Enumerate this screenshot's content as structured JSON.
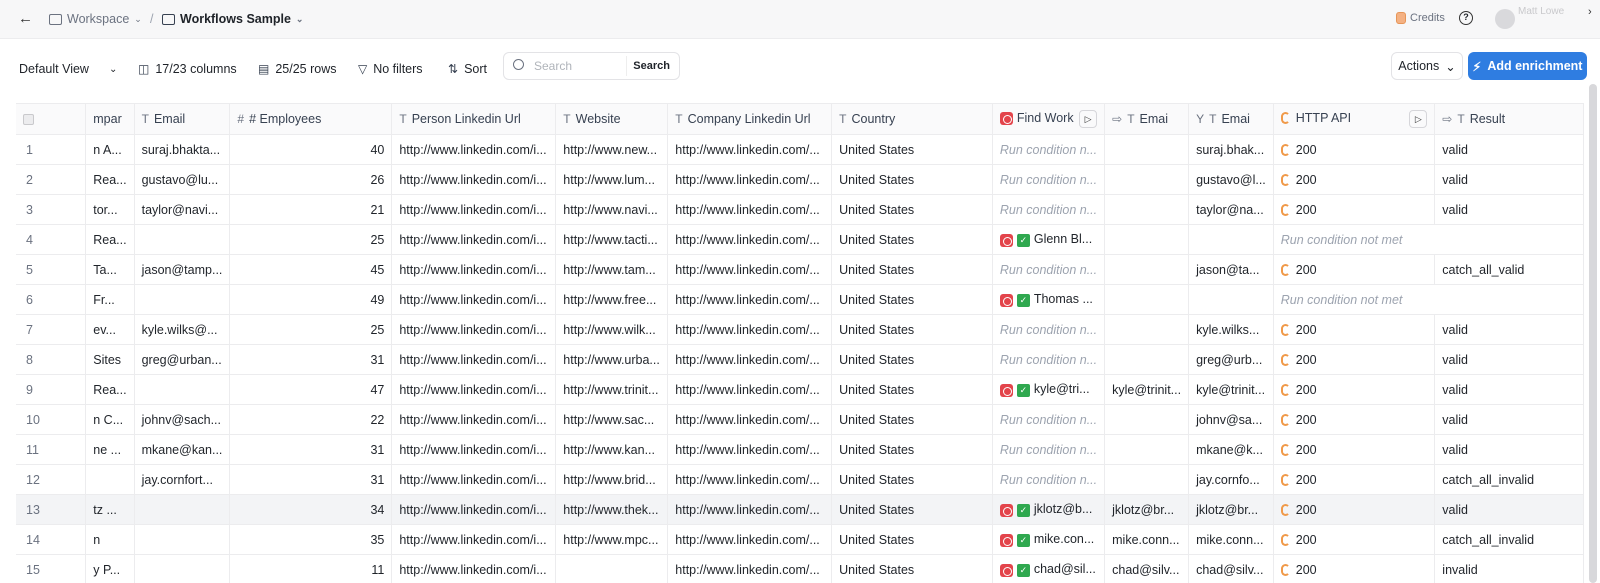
{
  "topbar": {
    "workspace": "Workspace",
    "separator": "/",
    "workflow": "Workflows Sample",
    "credits": "Credits",
    "user": "Matt Lowe"
  },
  "toolbar": {
    "view": "Default View",
    "columns": "17/23 columns",
    "rows": "25/25 rows",
    "filters": "No filters",
    "sort": "Sort",
    "search_placeholder": "Search",
    "search_button": "Search",
    "actions": "Actions",
    "add_enrichment": "Add enrichment"
  },
  "columns": [
    "mpar",
    "Email",
    "# Employees",
    "Person Linkedin Url",
    "Website",
    "Company Linkedin Url",
    "Country",
    "Find Work",
    "Emai",
    "Emai",
    "HTTP API",
    "Result"
  ],
  "rows": [
    {
      "n": "1",
      "company": "n A...",
      "email": "suraj.bhakta...",
      "employees": "40",
      "person": "http://www.linkedin.com/i...",
      "website": "http://www.new...",
      "clinkedin": "http://www.linkedin.com/...",
      "country": "United States",
      "findwork": "Run condition n...",
      "email2": "",
      "email3": "suraj.bhak...",
      "api": "200",
      "result": "valid"
    },
    {
      "n": "2",
      "company": "Rea...",
      "email": "gustavo@lu...",
      "employees": "26",
      "person": "http://www.linkedin.com/i...",
      "website": "http://www.lum...",
      "clinkedin": "http://www.linkedin.com/...",
      "country": "United States",
      "findwork": "Run condition n...",
      "email2": "",
      "email3": "gustavo@l...",
      "api": "200",
      "result": "valid"
    },
    {
      "n": "3",
      "company": "tor...",
      "email": "taylor@navi...",
      "employees": "21",
      "person": "http://www.linkedin.com/i...",
      "website": "http://www.navi...",
      "clinkedin": "http://www.linkedin.com/...",
      "country": "United States",
      "findwork": "Run condition n...",
      "email2": "",
      "email3": "taylor@na...",
      "api": "200",
      "result": "valid"
    },
    {
      "n": "4",
      "company": "Rea...",
      "email": "",
      "employees": "25",
      "person": "http://www.linkedin.com/i...",
      "website": "http://www.tacti...",
      "clinkedin": "http://www.linkedin.com/...",
      "country": "United States",
      "findwork": "Glenn Bl...",
      "email2": "",
      "email3": "",
      "api": "Run condition not met",
      "result": ""
    },
    {
      "n": "5",
      "company": "Ta...",
      "email": "jason@tamp...",
      "employees": "45",
      "person": "http://www.linkedin.com/i...",
      "website": "http://www.tam...",
      "clinkedin": "http://www.linkedin.com/...",
      "country": "United States",
      "findwork": "Run condition n...",
      "email2": "",
      "email3": "jason@ta...",
      "api": "200",
      "result": "catch_all_valid"
    },
    {
      "n": "6",
      "company": "Fr...",
      "email": "",
      "employees": "49",
      "person": "http://www.linkedin.com/i...",
      "website": "http://www.free...",
      "clinkedin": "http://www.linkedin.com/...",
      "country": "United States",
      "findwork": "Thomas ...",
      "email2": "",
      "email3": "",
      "api": "Run condition not met",
      "result": ""
    },
    {
      "n": "7",
      "company": "ev...",
      "email": "kyle.wilks@...",
      "employees": "25",
      "person": "http://www.linkedin.com/i...",
      "website": "http://www.wilk...",
      "clinkedin": "http://www.linkedin.com/...",
      "country": "United States",
      "findwork": "Run condition n...",
      "email2": "",
      "email3": "kyle.wilks...",
      "api": "200",
      "result": "valid"
    },
    {
      "n": "8",
      "company": "Sites",
      "email": "greg@urban...",
      "employees": "31",
      "person": "http://www.linkedin.com/i...",
      "website": "http://www.urba...",
      "clinkedin": "http://www.linkedin.com/...",
      "country": "United States",
      "findwork": "Run condition n...",
      "email2": "",
      "email3": "greg@urb...",
      "api": "200",
      "result": "valid"
    },
    {
      "n": "9",
      "company": "Rea...",
      "email": "",
      "employees": "47",
      "person": "http://www.linkedin.com/i...",
      "website": "http://www.trinit...",
      "clinkedin": "http://www.linkedin.com/...",
      "country": "United States",
      "findwork": "kyle@tri...",
      "email2": "kyle@trinit...",
      "email3": "kyle@trinit...",
      "api": "200",
      "result": "valid"
    },
    {
      "n": "10",
      "company": "n C...",
      "email": "johnv@sach...",
      "employees": "22",
      "person": "http://www.linkedin.com/i...",
      "website": "http://www.sac...",
      "clinkedin": "http://www.linkedin.com/...",
      "country": "United States",
      "findwork": "Run condition n...",
      "email2": "",
      "email3": "johnv@sa...",
      "api": "200",
      "result": "valid"
    },
    {
      "n": "11",
      "company": "ne ...",
      "email": "mkane@kan...",
      "employees": "31",
      "person": "http://www.linkedin.com/i...",
      "website": "http://www.kan...",
      "clinkedin": "http://www.linkedin.com/...",
      "country": "United States",
      "findwork": "Run condition n...",
      "email2": "",
      "email3": "mkane@k...",
      "api": "200",
      "result": "valid"
    },
    {
      "n": "12",
      "company": "",
      "email": "jay.cornfort...",
      "employees": "31",
      "person": "http://www.linkedin.com/i...",
      "website": "http://www.brid...",
      "clinkedin": "http://www.linkedin.com/...",
      "country": "United States",
      "findwork": "Run condition n...",
      "email2": "",
      "email3": "jay.cornfo...",
      "api": "200",
      "result": "catch_all_invalid"
    },
    {
      "n": "13",
      "company": "tz ...",
      "email": "",
      "employees": "34",
      "person": "http://www.linkedin.com/i...",
      "website": "http://www.thek...",
      "clinkedin": "http://www.linkedin.com/...",
      "country": "United States",
      "findwork": "jklotz@b...",
      "email2": "jklotz@br...",
      "email3": "jklotz@br...",
      "api": "200",
      "result": "valid"
    },
    {
      "n": "14",
      "company": "n",
      "email": "",
      "employees": "35",
      "person": "http://www.linkedin.com/i...",
      "website": "http://www.mpc...",
      "clinkedin": "http://www.linkedin.com/...",
      "country": "United States",
      "findwork": "mike.con...",
      "email2": "mike.conn...",
      "email3": "mike.conn...",
      "api": "200",
      "result": "catch_all_invalid"
    },
    {
      "n": "15",
      "company": "y P...",
      "email": "",
      "employees": "11",
      "person": "http://www.linkedin.com/i...",
      "website": "",
      "clinkedin": "http://www.linkedin.com/...",
      "country": "United States",
      "findwork": "chad@sil...",
      "email2": "chad@silv...",
      "email3": "chad@silv...",
      "api": "200",
      "result": "invalid"
    }
  ]
}
